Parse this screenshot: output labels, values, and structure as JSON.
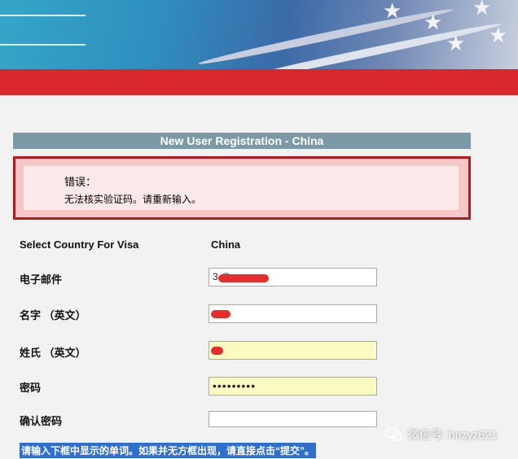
{
  "header": {
    "accent_color": "#d9282c"
  },
  "page_title": "New User Registration - China",
  "error": {
    "title": "错误：",
    "message": "无法核实验证码。请重新输入。"
  },
  "form": {
    "country_label": "Select Country For Visa",
    "country_value": "China",
    "email_label": "电子邮件",
    "email_value": "3          @qq.com",
    "given_name_label": "名字 （英文）",
    "surname_label": "姓氏 （英文）",
    "password_label": "密码",
    "password_value": "•••••••••",
    "confirm_password_label": "确认密码"
  },
  "instructions": "请输入下框中显示的单词。如果并无方框出现，请直接点击“提交”。",
  "watermark": {
    "icon": "wechat-icon",
    "text": "微信号: hnzyz621"
  }
}
